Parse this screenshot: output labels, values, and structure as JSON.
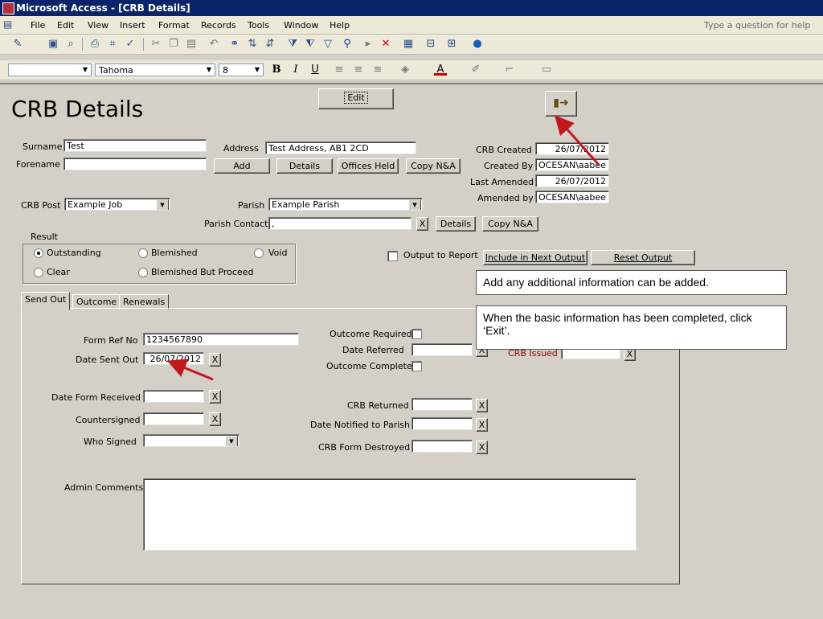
{
  "window": {
    "title": "Microsoft Access - [CRB Details]"
  },
  "menu": {
    "items": [
      "File",
      "Edit",
      "View",
      "Insert",
      "Format",
      "Records",
      "Tools",
      "Window",
      "Help"
    ],
    "help_placeholder": "Type a question for help"
  },
  "format_toolbar": {
    "font": "Tahoma",
    "size": "8",
    "bold": "B",
    "italic": "I",
    "underline": "U"
  },
  "form": {
    "title": "CRB Details",
    "edit_label": "Edit",
    "surname_label": "Surname",
    "surname_value": "Test",
    "forename_label": "Forename",
    "forename_value": "",
    "address_label": "Address",
    "address_value": "Test Address, AB1 2CD",
    "add_label": "Add",
    "details_label": "Details",
    "offices_label": "Offices Held",
    "copy_label": "Copy N&A",
    "crb_created_label": "CRB Created",
    "crb_created_value": "26/07/2012",
    "created_by_label": "Created By",
    "created_by_value": "OCESAN\\aabee",
    "last_amended_label": "Last Amended",
    "last_amended_value": "26/07/2012",
    "amended_by_label": "Amended by",
    "amended_by_value": "OCESAN\\aabee",
    "crb_post_label": "CRB Post",
    "crb_post_value": "Example Job",
    "parish_label": "Parish",
    "parish_value": "Example Parish",
    "parish_contact_label": "Parish Contact",
    "parish_contact_value": ",",
    "x_label": "X",
    "result_label": "Result",
    "result_outstanding": "Outstanding",
    "result_blemished": "Blemished",
    "result_void": "Void",
    "result_clear": "Clear",
    "result_blemished_proceed": "Blemished But Proceed",
    "output_to_report_label": "Output to Report",
    "include_next_label": "Include in Next Output",
    "reset_output_label": "Reset Output"
  },
  "tabs": [
    "Send Out",
    "Outcome",
    "Renewals"
  ],
  "sendout": {
    "form_ref_label": "Form Ref No",
    "form_ref_value": "1234567890",
    "date_sent_label": "Date Sent Out",
    "date_sent_value": "26/07/2012",
    "date_form_received_label": "Date Form Received",
    "countersigned_label": "Countersigned",
    "who_signed_label": "Who Signed",
    "outcome_required_label": "Outcome Required",
    "date_referred_label": "Date Referred",
    "outcome_complete_label": "Outcome Complete",
    "crb_issued_label": "CRB Issued",
    "crb_returned_label": "CRB Returned",
    "date_notified_label": "Date Notified to Parish",
    "crb_form_destroyed_label": "CRB Form Destroyed",
    "admin_comments_label": "Admin Comments"
  },
  "callouts": {
    "additional": "Add any additional information can be added.",
    "exit": "When the basic information has been completed, click ‘Exit’."
  },
  "colors": {
    "titlebar": "#0a246a",
    "arrow": "#c0181c",
    "crb_issued": "#8b0000"
  }
}
